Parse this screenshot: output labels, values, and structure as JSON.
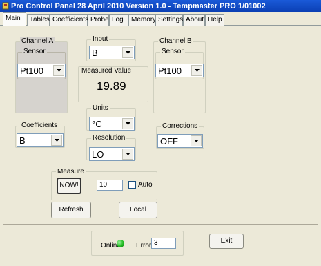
{
  "window": {
    "title": "Pro Control Panel 28 April 2010 Version 1.0 - Tempmaster PRO 1/01002",
    "icon": "app-icon"
  },
  "tabs": [
    {
      "label": "Main",
      "active": true
    },
    {
      "label": "Tables"
    },
    {
      "label": "Coefficients"
    },
    {
      "label": "Probe"
    },
    {
      "label": "Log"
    },
    {
      "label": "Memory"
    },
    {
      "label": "Settings"
    },
    {
      "label": "About"
    },
    {
      "label": "Help"
    }
  ],
  "channel_a": {
    "label": "Channel A",
    "sensor_label": "Sensor",
    "sensor_value": "Pt100"
  },
  "input": {
    "label": "Input",
    "value": "B"
  },
  "measured": {
    "label": "Measured Value",
    "value": "19.89"
  },
  "channel_b": {
    "label": "Channel B",
    "sensor_label": "Sensor",
    "sensor_value": "Pt100"
  },
  "units": {
    "label": "Units",
    "value": "°C"
  },
  "coefficients": {
    "label": "Coefficients",
    "value": "B"
  },
  "resolution": {
    "label": "Resolution",
    "value": "LO"
  },
  "corrections": {
    "label": "Corrections",
    "value": "OFF"
  },
  "measure": {
    "label": "Measure",
    "now_label": "NOW!",
    "interval_value": "10",
    "auto_label": "Auto",
    "auto_checked": false
  },
  "buttons": {
    "refresh": "Refresh",
    "local": "Local",
    "exit": "Exit"
  },
  "status": {
    "online_label": "Online",
    "online_color": "#22bb22",
    "error_label": "Error",
    "error_value": "3"
  }
}
